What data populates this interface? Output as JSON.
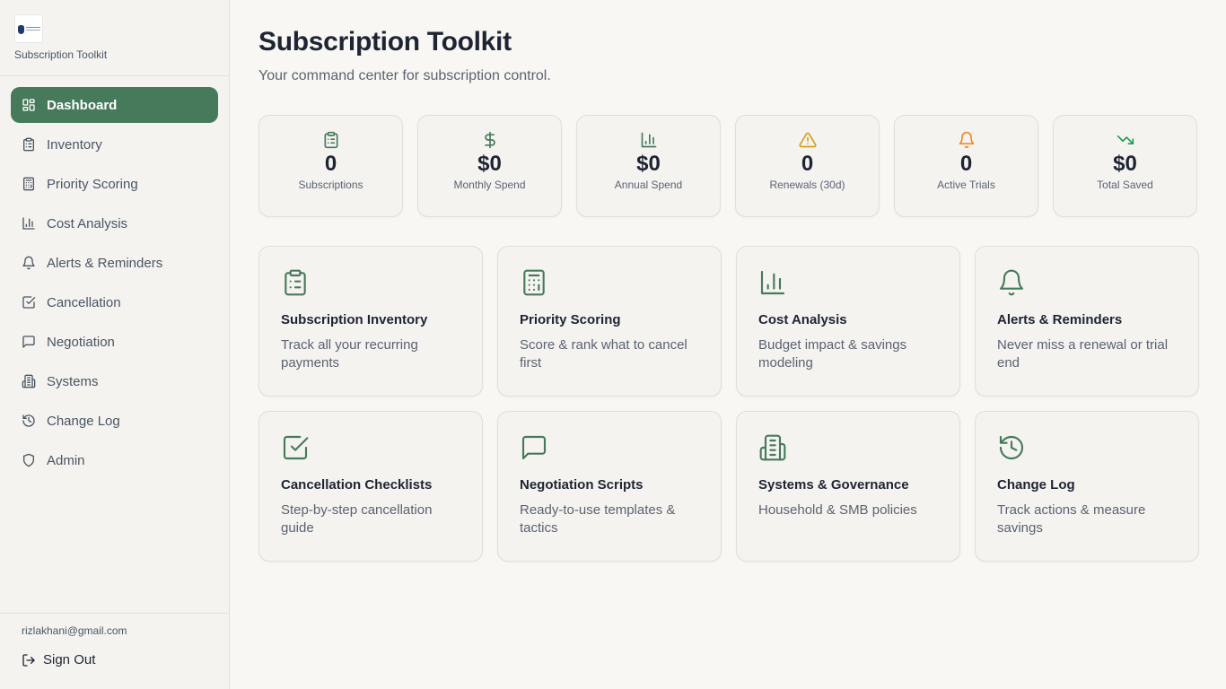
{
  "brand": {
    "name": "Subscription Toolkit"
  },
  "nav": [
    {
      "label": "Dashboard",
      "icon": "dashboard-icon"
    },
    {
      "label": "Inventory",
      "icon": "clipboard-icon"
    },
    {
      "label": "Priority Scoring",
      "icon": "calculator-icon"
    },
    {
      "label": "Cost Analysis",
      "icon": "bar-chart-icon"
    },
    {
      "label": "Alerts & Reminders",
      "icon": "bell-icon"
    },
    {
      "label": "Cancellation",
      "icon": "check-square-icon"
    },
    {
      "label": "Negotiation",
      "icon": "message-icon"
    },
    {
      "label": "Systems",
      "icon": "building-icon"
    },
    {
      "label": "Change Log",
      "icon": "history-icon"
    },
    {
      "label": "Admin",
      "icon": "shield-icon"
    }
  ],
  "user": {
    "email": "rizlakhani@gmail.com",
    "signout_label": "Sign Out"
  },
  "header": {
    "title": "Subscription Toolkit",
    "subtitle": "Your command center for subscription control."
  },
  "stats": [
    {
      "value": "0",
      "label": "Subscriptions",
      "icon": "clipboard-icon",
      "color": "#477a5a"
    },
    {
      "value": "$0",
      "label": "Monthly Spend",
      "icon": "dollar-icon",
      "color": "#477a5a"
    },
    {
      "value": "$0",
      "label": "Annual Spend",
      "icon": "bar-chart-icon",
      "color": "#477a5a"
    },
    {
      "value": "0",
      "label": "Renewals (30d)",
      "icon": "warning-icon",
      "color": "#d4a017"
    },
    {
      "value": "0",
      "label": "Active Trials",
      "icon": "bell-icon",
      "color": "#f08a24"
    },
    {
      "value": "$0",
      "label": "Total Saved",
      "icon": "trending-down-icon",
      "color": "#1f9d55"
    }
  ],
  "cards": [
    {
      "title": "Subscription Inventory",
      "desc": "Track all your recurring payments",
      "icon": "clipboard-icon"
    },
    {
      "title": "Priority Scoring",
      "desc": "Score & rank what to cancel first",
      "icon": "calculator-icon"
    },
    {
      "title": "Cost Analysis",
      "desc": "Budget impact & savings modeling",
      "icon": "bar-chart-icon"
    },
    {
      "title": "Alerts & Reminders",
      "desc": "Never miss a renewal or trial end",
      "icon": "bell-icon"
    },
    {
      "title": "Cancellation Checklists",
      "desc": "Step-by-step cancellation guide",
      "icon": "check-square-icon"
    },
    {
      "title": "Negotiation Scripts",
      "desc": "Ready-to-use templates & tactics",
      "icon": "message-icon"
    },
    {
      "title": "Systems & Governance",
      "desc": "Household & SMB policies",
      "icon": "building-icon"
    },
    {
      "title": "Change Log",
      "desc": "Track actions & measure savings",
      "icon": "history-icon"
    }
  ],
  "colors": {
    "accent": "#477a5a",
    "text": "#1f2433",
    "muted": "#5b6270"
  }
}
